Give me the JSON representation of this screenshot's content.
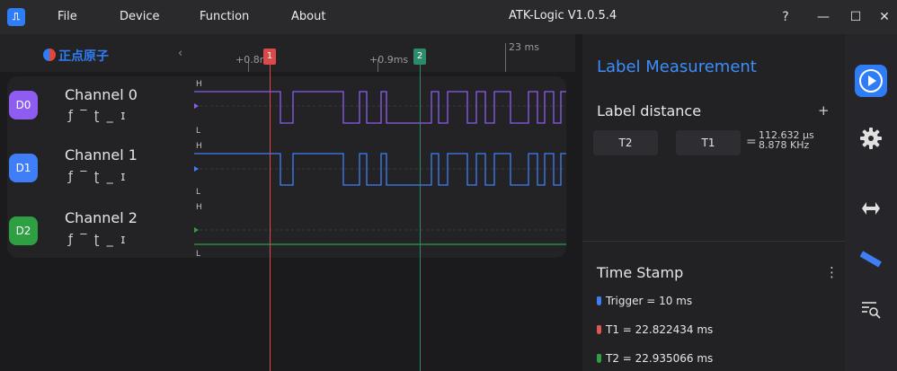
{
  "app": {
    "icon_label": "JUL",
    "title": "ATK-Logic  V1.0.5.4"
  },
  "menu": [
    "File",
    "Device",
    "Function",
    "About"
  ],
  "window_controls": {
    "help": "?",
    "minimize": "—",
    "maximize": "☐",
    "close": "✕"
  },
  "ruler": {
    "logo_text": "正点原子",
    "nav_prev": "‹",
    "labels": [
      "+0.8m",
      "+0.9ms",
      "23 ms"
    ]
  },
  "markers": [
    {
      "label": "1",
      "color": "#d94b4b"
    },
    {
      "label": "2",
      "color": "#2e8b6a"
    }
  ],
  "channels": [
    {
      "badge": "D0",
      "name": "Channel 0",
      "color": "#8e5cf0",
      "triggers": "ƒ ‾ ʈ _ ɪ",
      "high": "H",
      "low": "L"
    },
    {
      "badge": "D1",
      "name": "Channel 1",
      "color": "#3f7ef7",
      "triggers": "ƒ ‾ ʈ _ ɪ",
      "high": "H",
      "low": "L"
    },
    {
      "badge": "D2",
      "name": "Channel 2",
      "color": "#2ea043",
      "triggers": "ƒ ‾ ʈ _ ɪ",
      "high": "H",
      "low": "L"
    }
  ],
  "measurement": {
    "title": "Label Measurement",
    "label_distance": "Label distance",
    "add": "+",
    "from": "T2",
    "separator": "-",
    "to": "T1",
    "equals": "=",
    "time_result": "112.632 μs",
    "freq_result": "8.878 KHz"
  },
  "timestamp": {
    "title": "Time Stamp",
    "more": "⋮",
    "items": [
      {
        "text": "Trigger = 10 ms",
        "color": "#3f7ef7"
      },
      {
        "text": "T1 = 22.822434 ms",
        "color": "#e05555"
      },
      {
        "text": "T2 = 22.935066 ms",
        "color": "#2ea043"
      }
    ]
  },
  "sidebar": {
    "icons": [
      "play-icon",
      "settings-icon",
      "waveform-icon",
      "ruler-icon",
      "search-list-icon"
    ]
  }
}
